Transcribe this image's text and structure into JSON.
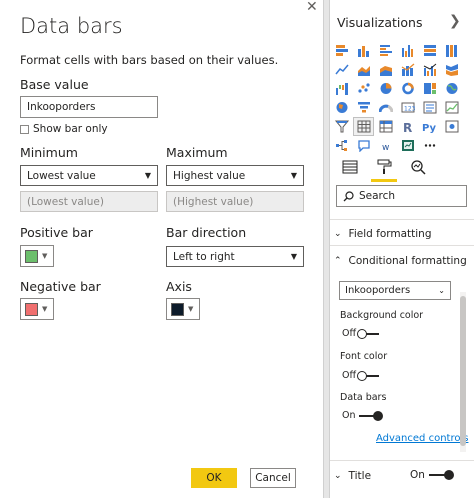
{
  "dialog": {
    "title": "Data bars",
    "description": "Format cells with bars based on their values.",
    "base_value": {
      "label": "Base value",
      "value": "Inkooporders"
    },
    "show_bar_only": {
      "label": "Show bar only",
      "checked": false
    },
    "minimum": {
      "label": "Minimum",
      "selected": "Lowest value",
      "value_placeholder": "(Lowest value)"
    },
    "maximum": {
      "label": "Maximum",
      "selected": "Highest value",
      "value_placeholder": "(Highest value)"
    },
    "positive_bar": {
      "label": "Positive bar",
      "color": "#6cbf6c"
    },
    "bar_direction": {
      "label": "Bar direction",
      "selected": "Left to right"
    },
    "negative_bar": {
      "label": "Negative bar",
      "color": "#f06f6f"
    },
    "axis": {
      "label": "Axis",
      "color": "#0d1b2a"
    },
    "ok_label": "OK",
    "cancel_label": "Cancel",
    "close_glyph": "✕"
  },
  "viz_pane": {
    "title": "Visualizations",
    "collapse_glyph": "❯",
    "search_placeholder": "Search",
    "sections": {
      "field_formatting": "Field formatting",
      "conditional_formatting": "Conditional formatting",
      "title": "Title"
    },
    "conditional": {
      "field": "Inkooporders",
      "background_color": {
        "label": "Background color",
        "state": "Off"
      },
      "font_color": {
        "label": "Font color",
        "state": "Off"
      },
      "data_bars": {
        "label": "Data bars",
        "state": "On"
      },
      "advanced_link": "Advanced controls"
    },
    "title_toggle": "On",
    "accent_color": "#f2c811"
  }
}
